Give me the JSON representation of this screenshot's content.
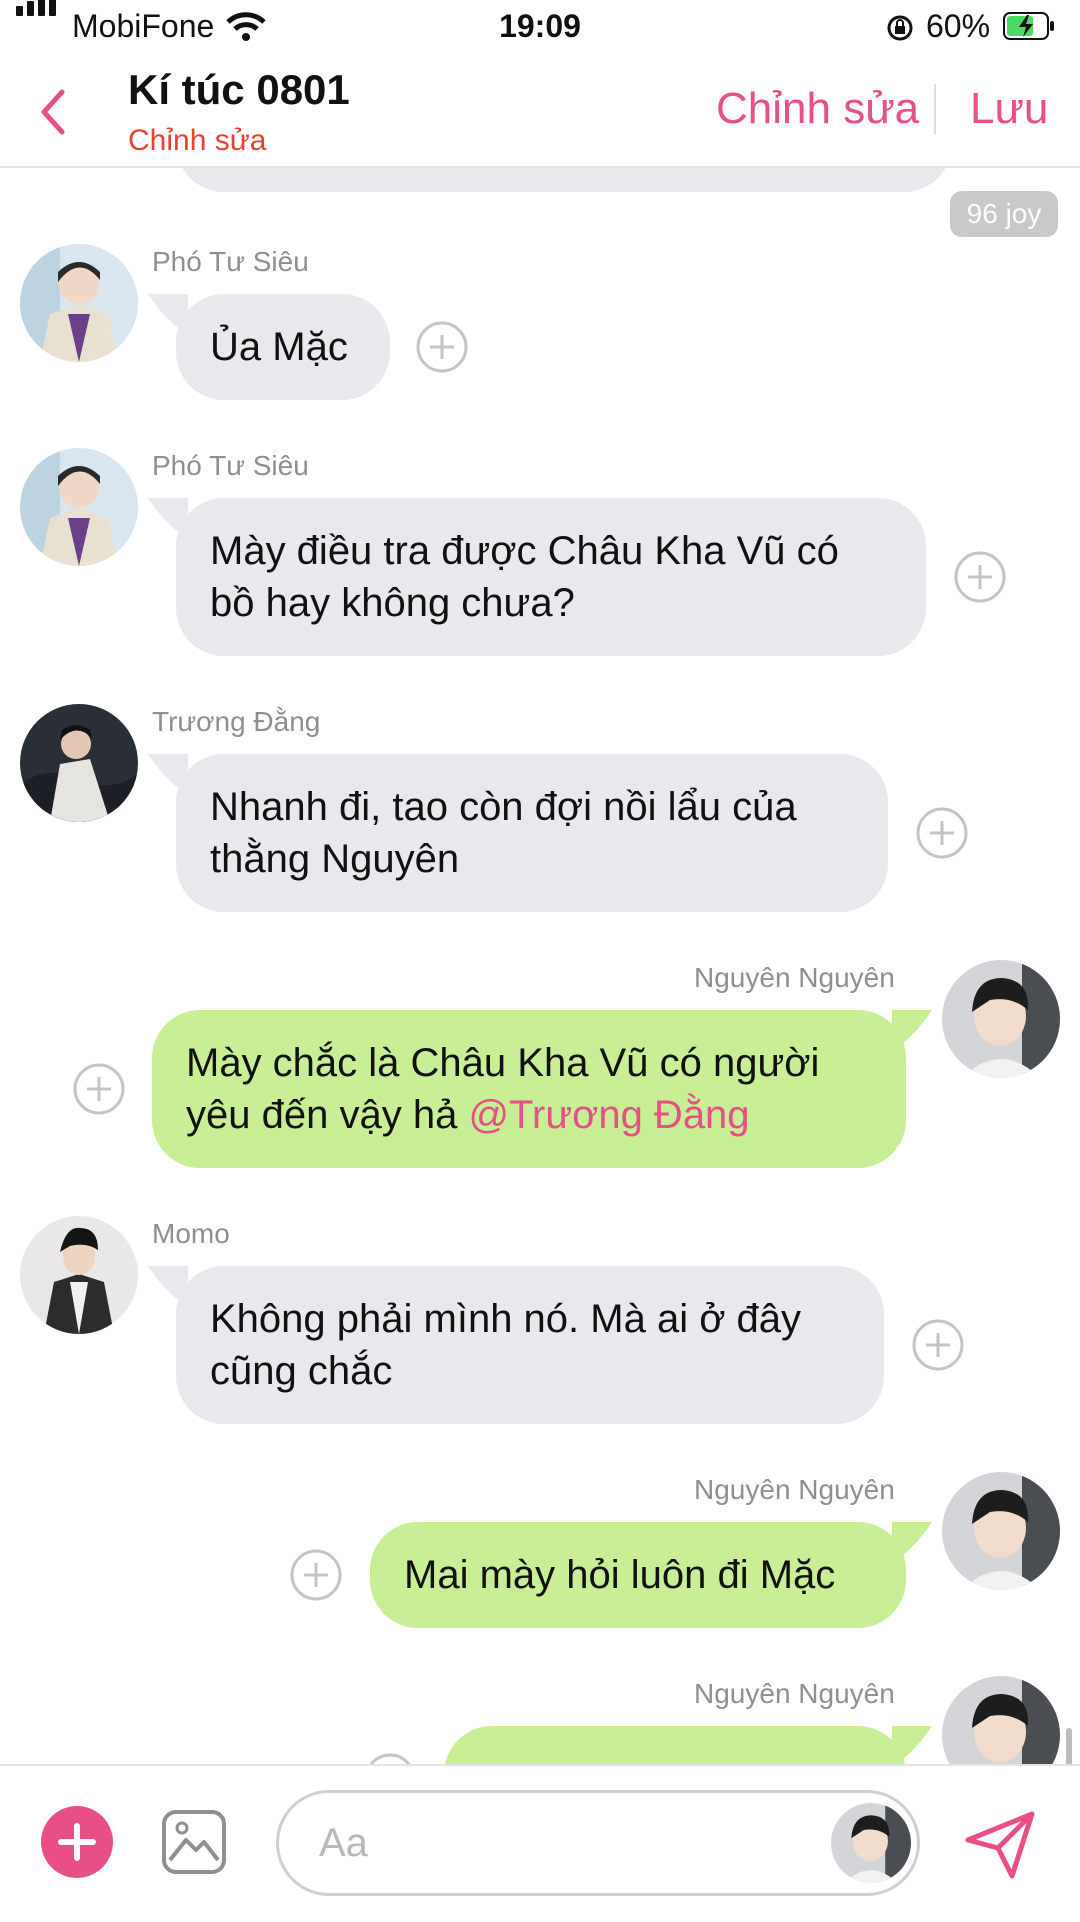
{
  "status_bar": {
    "carrier": "MobiFone",
    "time": "19:09",
    "battery": "60%"
  },
  "header": {
    "title": "Kí túc 0801",
    "subtitle": "Chỉnh sửa",
    "edit_label": "Chỉnh sửa",
    "save_label": "Lưu"
  },
  "reaction_badge": "96 joy",
  "messages": [
    {
      "sender": "Phó Tư Siêu",
      "lines": [
        "Ủa Mặc"
      ]
    },
    {
      "sender": "Phó Tư Siêu",
      "lines": [
        "Mày điều tra được Châu Kha Vũ có",
        "bồ hay không chưa?"
      ]
    },
    {
      "sender": "Trương Đằng",
      "lines": [
        "Nhanh đi, tao còn đợi nồi lẩu của",
        "thằng Nguyên"
      ]
    },
    {
      "sender": "Nguyên Nguyên",
      "lines": [
        "Mày chắc là Châu Kha Vũ có người",
        "yêu đến vậy hả"
      ],
      "mention": "@Trương Đằng"
    },
    {
      "sender": "Momo",
      "lines": [
        "Không phải mình nó. Mà ai ở đây",
        "cũng chắc"
      ]
    },
    {
      "sender": "Nguyên Nguyên",
      "lines": [
        "Mai mày hỏi luôn đi Mặc"
      ]
    },
    {
      "sender": "Nguyên Nguyên",
      "lines": []
    }
  ],
  "composer": {
    "placeholder": "Aa"
  },
  "colors": {
    "accent": "#e84f86",
    "subtitle": "#e5422f",
    "incoming_bubble": "#e8e9ec",
    "outgoing_bubble": "#c8ef95"
  },
  "icons": [
    "back-chevron-icon",
    "plus-circle-icon",
    "gallery-icon",
    "send-icon",
    "add-icon"
  ]
}
